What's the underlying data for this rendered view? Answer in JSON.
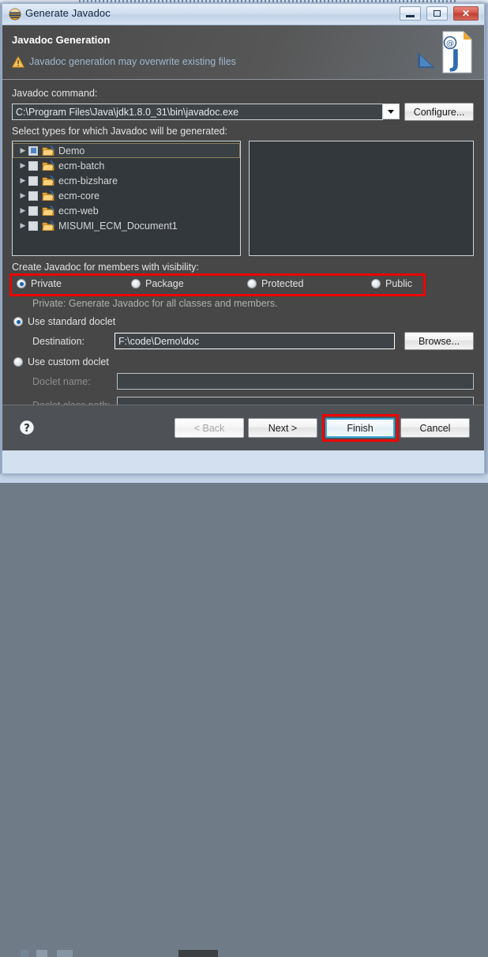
{
  "window": {
    "title": "Generate Javadoc",
    "app_icon": "javadoc-app-icon",
    "minimize_label": "Minimize",
    "maximize_label": "Maximize",
    "close_label": "Close"
  },
  "banner": {
    "title": "Javadoc Generation",
    "warning_text": "Javadoc generation may overwrite existing files",
    "warning_icon": "warning-triangle-icon",
    "art_icon": "javadoc-page-icon"
  },
  "command": {
    "label": "Javadoc command:",
    "value": "C:\\Program Files\\Java\\jdk1.8.0_31\\bin\\javadoc.exe",
    "dropdown_icon": "chevron-down-icon",
    "configure_label": "Configure..."
  },
  "types": {
    "label": "Select types for which Javadoc will be generated:",
    "items": [
      {
        "label": "Demo",
        "checked": true,
        "selected": true
      },
      {
        "label": "ecm-batch",
        "checked": false,
        "selected": false
      },
      {
        "label": "ecm-bizshare",
        "checked": false,
        "selected": false
      },
      {
        "label": "ecm-core",
        "checked": false,
        "selected": false
      },
      {
        "label": "ecm-web",
        "checked": false,
        "selected": false
      },
      {
        "label": "MISUMI_ECM_Document1",
        "checked": false,
        "selected": false
      }
    ]
  },
  "visibility": {
    "label": "Create Javadoc for members with visibility:",
    "options": [
      {
        "label": "Private",
        "selected": true
      },
      {
        "label": "Package",
        "selected": false
      },
      {
        "label": "Protected",
        "selected": false
      },
      {
        "label": "Public",
        "selected": false
      }
    ],
    "description": "Private: Generate Javadoc for all classes and members."
  },
  "doclet": {
    "standard_label": "Use standard doclet",
    "standard_selected": true,
    "destination_label": "Destination:",
    "destination_value": "F:\\code\\Demo\\doc",
    "browse_label": "Browse...",
    "custom_label": "Use custom doclet",
    "custom_selected": false,
    "doclet_name_label": "Doclet name:",
    "doclet_name_value": "",
    "doclet_class_path_label": "Doclet class path:",
    "doclet_class_path_value": ""
  },
  "buttons": {
    "help_icon": "help-question-icon",
    "back_label": "< Back",
    "next_label": "Next >",
    "finish_label": "Finish",
    "cancel_label": "Cancel"
  },
  "colors": {
    "annotation": "#ef0000",
    "focus_ring": "#3fa9dd",
    "dialog_bg": "#474747",
    "banner_link": "#9fb7cf",
    "radio_dot": "#1063b0"
  }
}
